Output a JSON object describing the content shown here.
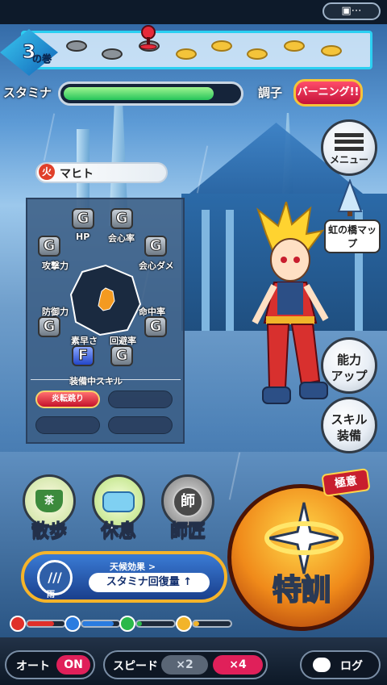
{
  "header": {
    "chat_icon": "chat-bubble-icon",
    "volume_number": "3",
    "volume_suffix": "の巻"
  },
  "status": {
    "stamina_label": "スタミナ",
    "stamina_fraction": 0.86,
    "condition_label": "調子",
    "condition_value": "バーニング!!"
  },
  "character": {
    "element": "火",
    "name": "マヒト"
  },
  "stats": {
    "items": [
      {
        "label": "HP",
        "grade": "G"
      },
      {
        "label": "会心率",
        "grade": "G"
      },
      {
        "label": "会心ダメ",
        "grade": "G"
      },
      {
        "label": "命中率",
        "grade": "G"
      },
      {
        "label": "回避率",
        "grade": "G"
      },
      {
        "label": "素早さ",
        "grade": "F"
      },
      {
        "label": "防御力",
        "grade": "G"
      },
      {
        "label": "攻撃力",
        "grade": "G"
      }
    ],
    "skills_title": "装備中スキル",
    "equipped_skill": "炎転跳り"
  },
  "side_menu": {
    "menu": "メニュー",
    "rainbow_bridge": "虹の橋マップ",
    "ability_up_1": "能力",
    "ability_up_2": "アップ",
    "skill_equip_1": "スキル",
    "skill_equip_2": "装備"
  },
  "actions": {
    "walk": "散歩",
    "walk_badge": "茶",
    "rest": "休息",
    "master": "師匠",
    "master_badge": "師",
    "train": "特訓",
    "train_badge": "極意"
  },
  "weather": {
    "icon_text": "///",
    "name": "雨",
    "effect_title": "天候効果 >",
    "effect_value": "スタミナ回復量 ↑"
  },
  "gauges": [
    {
      "icon": "fire-element-icon",
      "color": "#e0302a",
      "fill": 0.72
    },
    {
      "icon": "water-element-icon",
      "color": "#2a7ce0",
      "fill": 0.85
    },
    {
      "icon": "wind-element-icon",
      "color": "#2ab84a",
      "fill": 0.12
    },
    {
      "icon": "thunder-element-icon",
      "color": "#f2b42a",
      "fill": 0.15
    }
  ],
  "bottom_bar": {
    "auto_label": "オート",
    "auto_state": "ON",
    "speed_label": "スピード",
    "speed_x2": "×2",
    "speed_x4": "×4",
    "log_label": "ログ"
  }
}
